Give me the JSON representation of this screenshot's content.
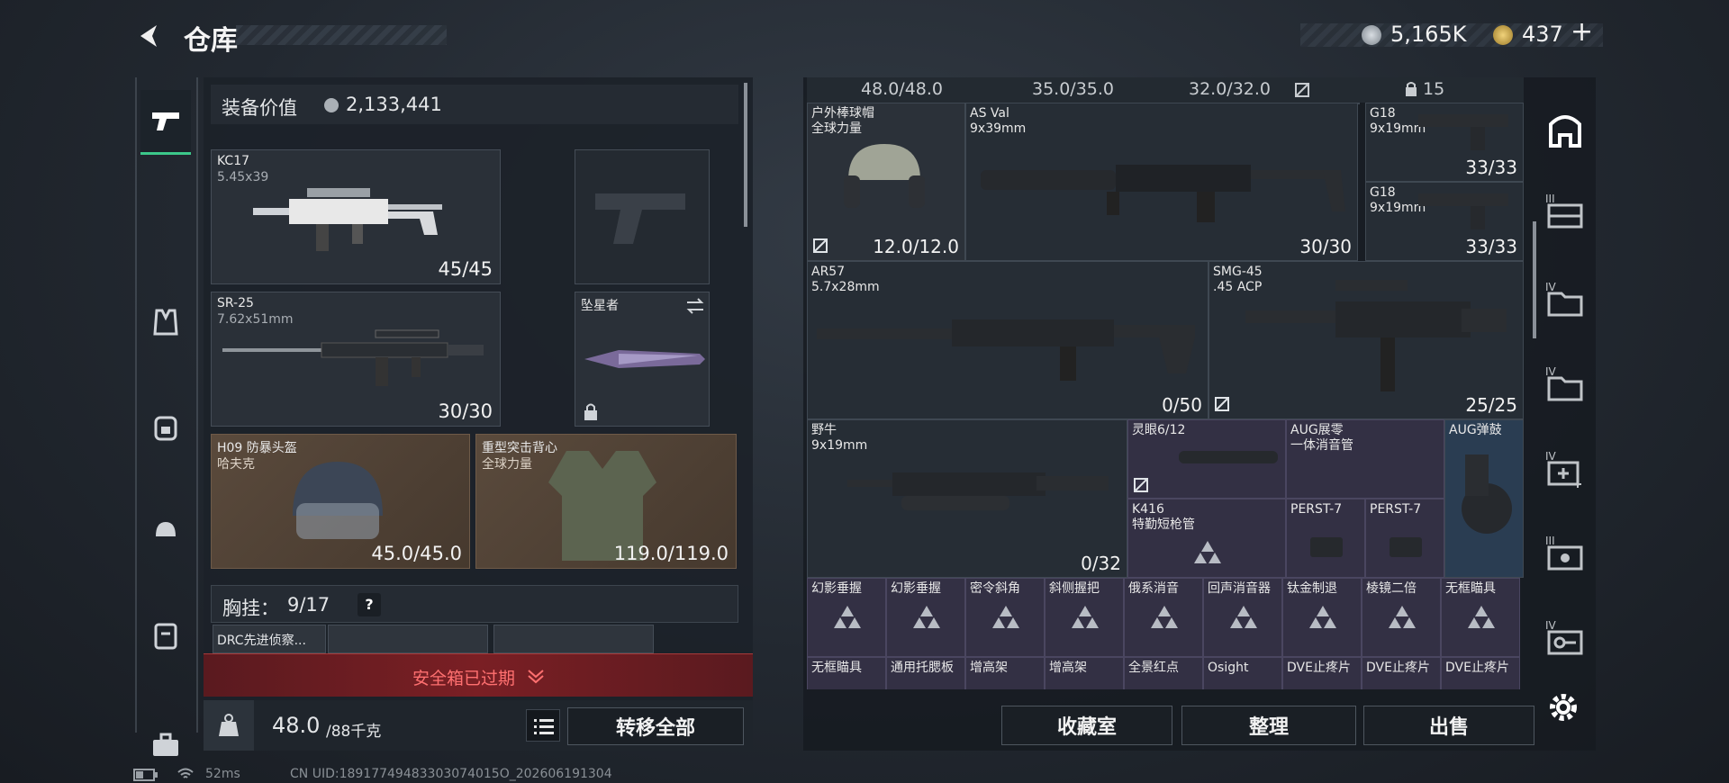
{
  "header": {
    "title": "仓库",
    "currency1": "5,165K",
    "currency2": "437",
    "plus": "+"
  },
  "loadout": {
    "value_label": "装备价值",
    "value": "2,133,441",
    "slots": [
      {
        "name": "KC17",
        "sub": "5.45x39",
        "count": "45/45"
      },
      {
        "name": "SR-25",
        "sub": "7.62x51mm",
        "count": "30/30"
      },
      {
        "name": "坠星者"
      },
      {
        "name": "H09 防暴头盔",
        "sub": "哈夫克",
        "count": "45.0/45.0"
      },
      {
        "name": "重型突击背心",
        "sub": "全球力量",
        "count": "119.0/119.0"
      }
    ],
    "chest_label": "胸挂：",
    "chest_count": "9/17",
    "chest_help": "?",
    "chest_item": "DRC先进侦察...",
    "safebox": "安全箱已过期",
    "weight": "48.0",
    "weight_max": "/88千克",
    "transfer_all": "转移全部"
  },
  "storage": {
    "top_values": [
      "48.0/48.0",
      "35.0/35.0",
      "32.0/32.0",
      "15"
    ],
    "items": [
      {
        "name": "户外棒球帽",
        "sub": "全球力量",
        "count": "12.0/12.0"
      },
      {
        "name": "AS Val",
        "sub": "9x39mm",
        "count": "30/30"
      },
      {
        "name": "G18",
        "sub": "9x19mm",
        "count": "33/33"
      },
      {
        "name": "G18",
        "sub": "9x19mm",
        "count": "33/33"
      },
      {
        "name": "AR57",
        "sub": "5.7x28mm",
        "count": "0/50"
      },
      {
        "name": "SMG-45",
        "sub": ".45 ACP",
        "count": "25/25"
      },
      {
        "name": "野牛",
        "sub": "9x19mm",
        "count": "0/32"
      },
      {
        "name": "灵眼6/12"
      },
      {
        "name": "AUG展零",
        "sub": "一体消音管"
      },
      {
        "name": "AUG弹鼓"
      },
      {
        "name": "K416",
        "sub": "特勤短枪管"
      },
      {
        "name": "PERST-7"
      },
      {
        "name": "PERST-7"
      }
    ],
    "row_small": [
      "幻影垂握",
      "幻影垂握",
      "密令斜角",
      "斜侧握把",
      "俄系消音",
      "回声消音器",
      "钛金制退",
      "棱镜二倍",
      "无框瞄具"
    ],
    "row_bottom": [
      "无框瞄具",
      "通用托腮板",
      "增高架",
      "增高架",
      "全景红点",
      "Osight",
      "DVE止疼片",
      "DVE止疼片",
      "DVE止疼片"
    ],
    "btn_collect": "收藏室",
    "btn_sort": "整理",
    "btn_sell": "出售"
  },
  "rightrail": {
    "labels": [
      "III",
      "IV",
      "IV",
      "IV",
      "III",
      "IV"
    ]
  },
  "footer": {
    "ping": "52ms",
    "uid": "CN UID:18917749483303074015O_202606191304"
  },
  "colors": {
    "accent_red": "#e05a5a",
    "safebox_bg": "#7a1f24",
    "purple": "#333044",
    "green_tab": "#3cc88a"
  }
}
